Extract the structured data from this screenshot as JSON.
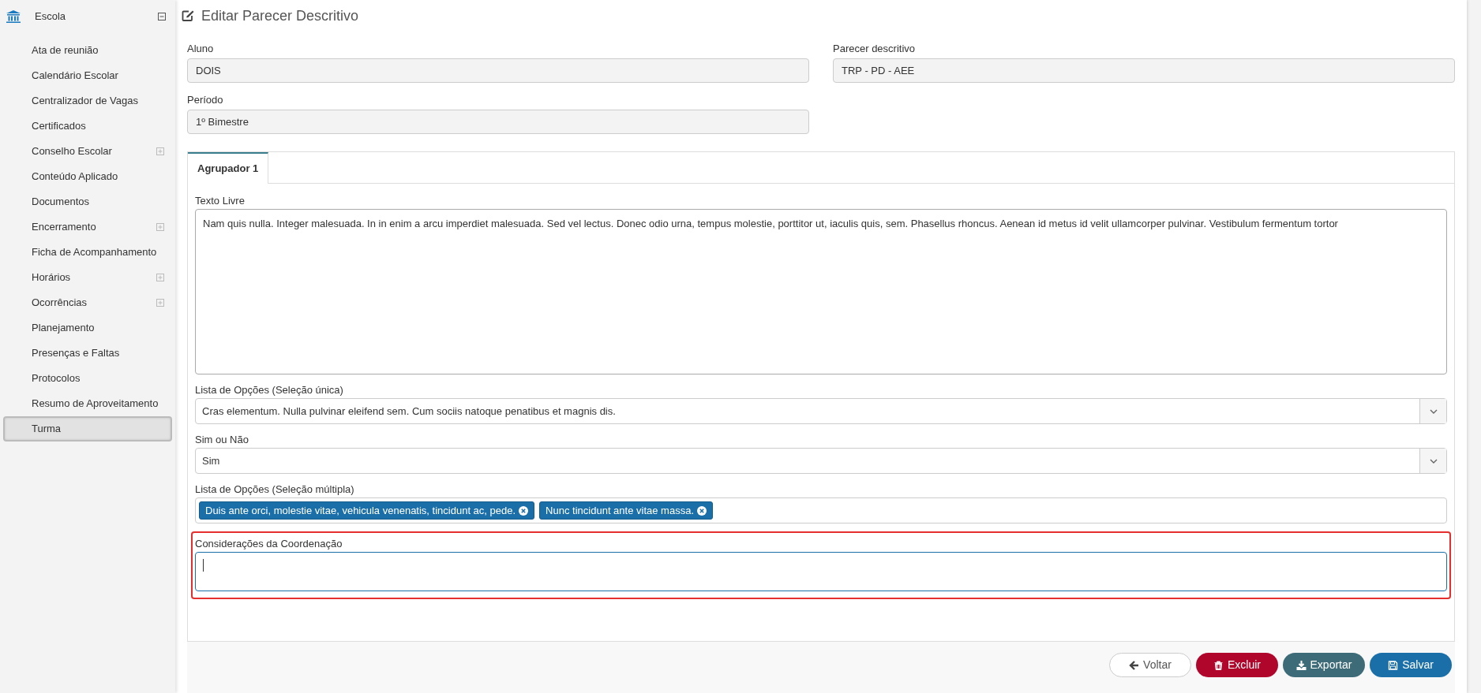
{
  "sidebar": {
    "section": {
      "label": "Escola",
      "expanded": true
    },
    "items": [
      {
        "label": "Ata de reunião",
        "expandable": false,
        "selected": false
      },
      {
        "label": "Calendário Escolar",
        "expandable": false,
        "selected": false
      },
      {
        "label": "Centralizador de Vagas",
        "expandable": false,
        "selected": false
      },
      {
        "label": "Certificados",
        "expandable": false,
        "selected": false
      },
      {
        "label": "Conselho Escolar",
        "expandable": true,
        "selected": false
      },
      {
        "label": "Conteúdo Aplicado",
        "expandable": false,
        "selected": false
      },
      {
        "label": "Documentos",
        "expandable": false,
        "selected": false
      },
      {
        "label": "Encerramento",
        "expandable": true,
        "selected": false
      },
      {
        "label": "Ficha de Acompanhamento",
        "expandable": false,
        "selected": false
      },
      {
        "label": "Horários",
        "expandable": true,
        "selected": false
      },
      {
        "label": "Ocorrências",
        "expandable": true,
        "selected": false
      },
      {
        "label": "Planejamento",
        "expandable": false,
        "selected": false
      },
      {
        "label": "Presenças e Faltas",
        "expandable": false,
        "selected": false
      },
      {
        "label": "Protocolos",
        "expandable": false,
        "selected": false
      },
      {
        "label": "Resumo de Aproveitamento",
        "expandable": false,
        "selected": false
      },
      {
        "label": "Turma",
        "expandable": false,
        "selected": true
      }
    ]
  },
  "page": {
    "title": "Editar Parecer Descritivo",
    "header_fields": [
      {
        "label": "Aluno",
        "value": "DOIS"
      },
      {
        "label": "Parecer descritivo",
        "value": "TRP - PD - AEE"
      },
      {
        "label": "Período",
        "value": "1º Bimestre"
      }
    ],
    "tabs": [
      {
        "label": "Agrupador 1",
        "selected": true
      }
    ],
    "questions": [
      {
        "kind": "textarea",
        "label": "Texto Livre",
        "value": "Nam quis nulla. Integer malesuada. In in enim a arcu imperdiet malesuada. Sed vel lectus. Donec odio urna, tempus molestie, porttitor ut, iaculis quis, sem. Phasellus rhoncus. Aenean id metus id velit ullamcorper pulvinar. Vestibulum fermentum tortor",
        "highlighted": false
      },
      {
        "kind": "select",
        "label": "Lista de Opções (Seleção única)",
        "value": "Cras elementum. Nulla pulvinar eleifend sem. Cum sociis natoque penatibus et magnis dis.",
        "highlighted": false
      },
      {
        "kind": "select",
        "label": "Sim ou Não",
        "value": "Sim",
        "highlighted": false
      },
      {
        "kind": "multiselect",
        "label": "Lista de Opções (Seleção múltipla)",
        "tags": [
          "Duis ante orci, molestie vitae, vehicula venenatis, tincidunt ac, pede.",
          "Nunc tincidunt ante vitae massa."
        ],
        "highlighted": false
      },
      {
        "kind": "input",
        "label": "Considerações da Coordenação",
        "highlighted": true
      }
    ]
  },
  "buttons": [
    {
      "kind": "back",
      "label": "Voltar"
    },
    {
      "kind": "delete",
      "label": "Excluir"
    },
    {
      "kind": "export",
      "label": "Exportar"
    },
    {
      "kind": "save",
      "label": "Salvar"
    }
  ]
}
